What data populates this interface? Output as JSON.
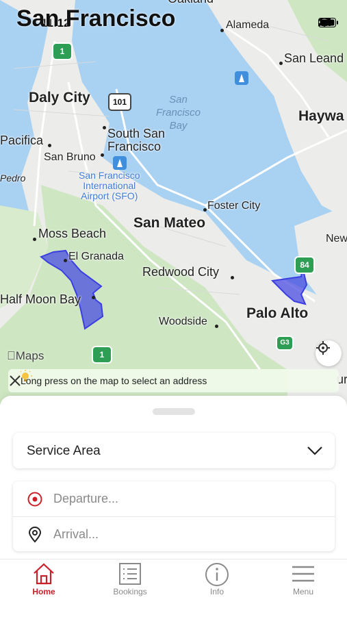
{
  "status_bar": {
    "time": "11:12"
  },
  "map": {
    "title": "San Francisco",
    "labels": {
      "oakland": "Oakland",
      "alameda": "Alameda",
      "san_leandro": "San Leand",
      "daly_city": "Daly City",
      "hayward": "Haywa",
      "pacifica": "Pacifica",
      "south_sf": "South San\nFrancisco",
      "san_bruno": "San Bruno",
      "pedro": "Pedro",
      "sf_bay": "San\nFrancisco\nBay",
      "sfo": "San Francisco\nInternational\nAirport (SFO)",
      "foster_city": "Foster City",
      "san_mateo": "San Mateo",
      "newark": "New",
      "moss_beach": "Moss Beach",
      "el_granada": "El Granada",
      "redwood_city": "Redwood City",
      "half_moon_bay": "Half Moon Bay",
      "woodside": "Woodside",
      "palo_alto": "Palo Alto",
      "edge_right": "ur"
    },
    "route_shields": {
      "hwy1_top": "1",
      "us101": "101",
      "i84": "84",
      "g3": "G3",
      "hwy1_bottom": "1"
    },
    "attribution": "Maps",
    "service_area_color": "#4a4ee0"
  },
  "hint": {
    "text": "Long press on the map to select an address"
  },
  "panel": {
    "service_area_label": "Service Area",
    "departure_placeholder": "Departure...",
    "arrival_placeholder": "Arrival..."
  },
  "tabs": [
    {
      "label": "Home",
      "icon": "home-icon",
      "active": true
    },
    {
      "label": "Bookings",
      "icon": "list-icon",
      "active": false
    },
    {
      "label": "Info",
      "icon": "info-icon",
      "active": false
    },
    {
      "label": "Menu",
      "icon": "menu-icon",
      "active": false
    }
  ],
  "colors": {
    "accent": "#c9202a",
    "water": "#a9d1f2",
    "land": "#ececea",
    "park": "#cfe6c3"
  }
}
